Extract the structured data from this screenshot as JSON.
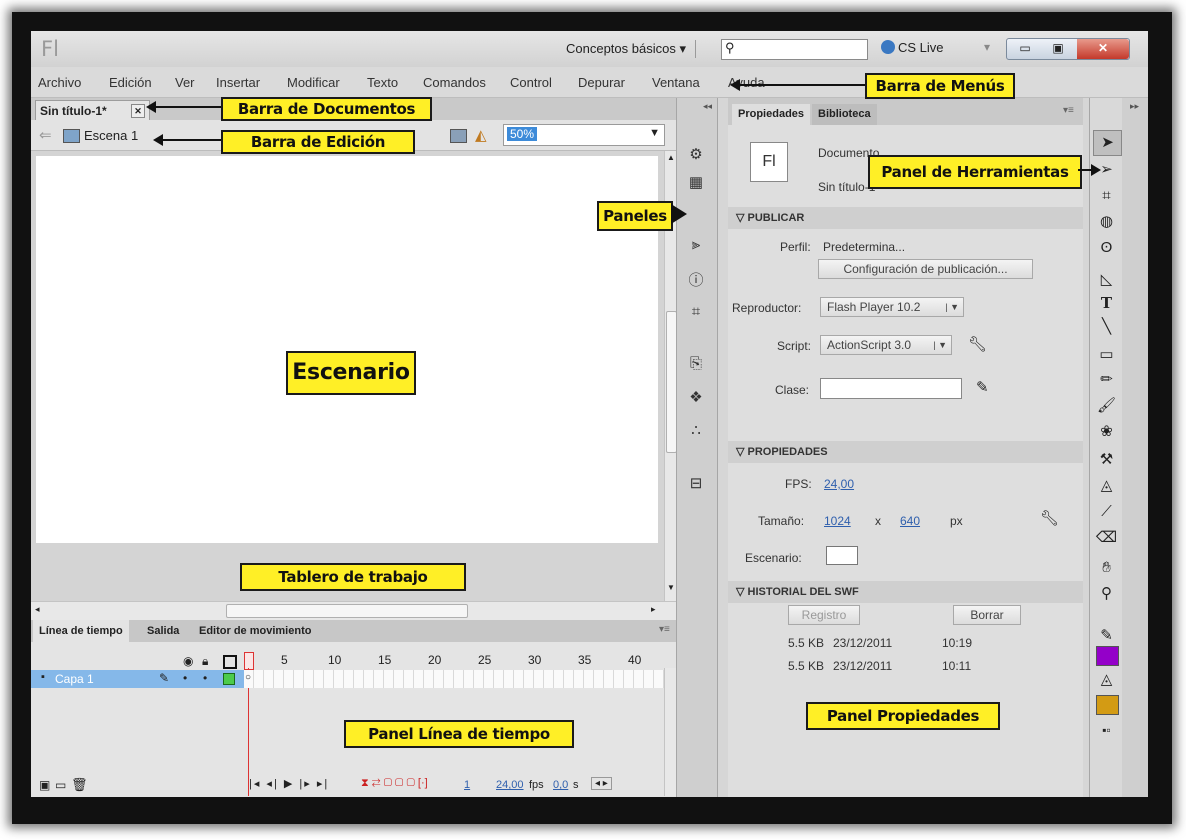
{
  "titlebar": {
    "logo": "Fl",
    "workspace": "Conceptos básicos",
    "search_value": "",
    "cs_live": "CS Live"
  },
  "menu": [
    "Archivo",
    "Edición",
    "Ver",
    "Insertar",
    "Modificar",
    "Texto",
    "Comandos",
    "Control",
    "Depurar",
    "Ventana",
    "Ayuda"
  ],
  "document": {
    "tab_label": "Sin título-1*",
    "scene": "Escena 1",
    "zoom": "50%"
  },
  "timeline": {
    "tabs": [
      "Línea de tiempo",
      "Salida",
      "Editor de movimiento"
    ],
    "frame_numbers": [
      "1",
      "5",
      "10",
      "15",
      "20",
      "25",
      "30",
      "35",
      "40"
    ],
    "layer_name": "Capa 1",
    "current_frame": "1",
    "fps": "24,00",
    "fps_unit": "fps",
    "time": "0,0",
    "time_unit": "s"
  },
  "properties": {
    "tabs": [
      "Propiedades",
      "Biblioteca"
    ],
    "doc_icon_text": "Fl",
    "doc_type": "Documento",
    "doc_name": "Sin título-1",
    "section_publish": "PUBLICAR",
    "profile_label": "Perfil:",
    "profile_value": "Predetermina...",
    "publish_settings_button": "Configuración de publicación...",
    "player_label": "Reproductor:",
    "player_value": "Flash Player 10.2",
    "script_label": "Script:",
    "script_value": "ActionScript 3.0",
    "class_label": "Clase:",
    "section_props": "PROPIEDADES",
    "fps_label": "FPS:",
    "fps_value": "24,00",
    "size_label": "Tamaño:",
    "width": "1024",
    "size_x": "x",
    "height": "640",
    "size_unit": "px",
    "stage_label": "Escenario:",
    "stage_color": "#ffffff",
    "section_history": "HISTORIAL DEL SWF",
    "log_button": "Registro",
    "clear_button": "Borrar",
    "history": [
      {
        "size": "5.5 KB",
        "date": "23/12/2011",
        "time": "10:19"
      },
      {
        "size": "5.5 KB",
        "date": "23/12/2011",
        "time": "10:11"
      }
    ]
  },
  "tools": {
    "stroke_color": "#9400c9",
    "fill_color": "#d39b14"
  },
  "callouts": {
    "menus": "Barra de Menús",
    "documents": "Barra de Documentos",
    "edition": "Barra de Edición",
    "tools": "Panel de Herramientas",
    "panels": "Paneles",
    "stage": "Escenario",
    "workboard": "Tablero de trabajo",
    "timeline": "Panel Línea de tiempo",
    "properties": "Panel Propiedades"
  }
}
